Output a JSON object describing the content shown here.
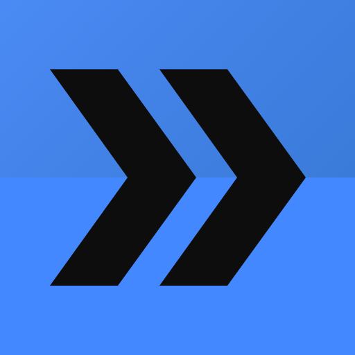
{
  "icon": {
    "name": "fast-forward-icon",
    "colors": {
      "background_top": "#3f80e6",
      "background_bottom": "#4488ff",
      "glyph": "#0d0d0d"
    }
  }
}
